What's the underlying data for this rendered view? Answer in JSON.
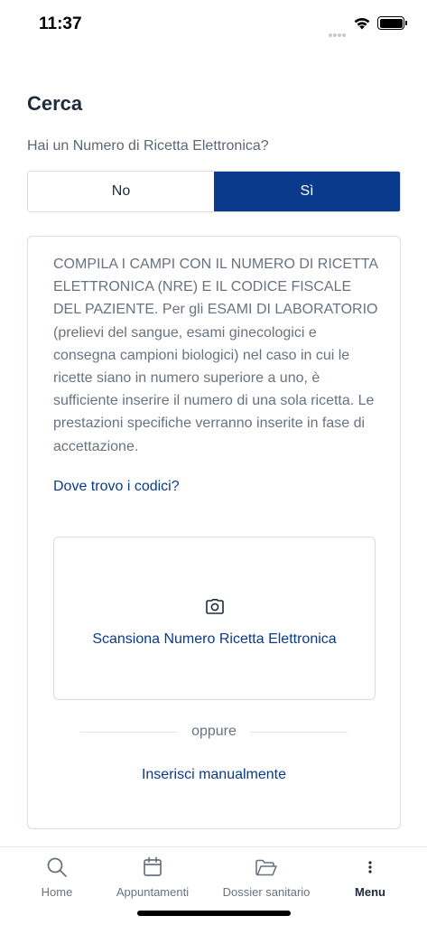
{
  "status_bar": {
    "time": "11:37"
  },
  "search": {
    "title": "Cerca",
    "question": "Hai un Numero di Ricetta Elettronica?",
    "segments": {
      "no": "No",
      "yes": "Sì"
    },
    "selected": "yes"
  },
  "card": {
    "instructions": "COMPILA I CAMPI CON IL NUMERO DI RICETTA ELETTRONICA (NRE) E IL CODICE FISCALE DEL PAZIENTE. Per gli ESAMI DI LABORATORIO (prelievi del sangue, esami ginecologici e consegna campioni biologici) nel caso in cui le ricette siano in numero superiore a uno, è sufficiente inserire il numero di una sola ricetta. Le prestazioni specifiche verranno inserite in fase di accettazione.",
    "where_link": "Dove trovo i codici?",
    "scan_icon": "camera-icon",
    "scan_label": "Scansiona Numero Ricetta Elettronica",
    "or_text": "oppure",
    "manual_link": "Inserisci manualmente"
  },
  "tab_bar": {
    "items": [
      {
        "label": "Home",
        "icon": "search-icon"
      },
      {
        "label": "Appuntamenti",
        "icon": "calendar-icon"
      },
      {
        "label": "Dossier sanitario",
        "icon": "folder-icon"
      },
      {
        "label": "Menu",
        "icon": "more-vertical-icon"
      }
    ],
    "active": "Menu"
  },
  "colors": {
    "primary": "#0a3a8c",
    "text": "#1f2a3a",
    "muted": "#6a7280",
    "border": "#d8dce2"
  }
}
